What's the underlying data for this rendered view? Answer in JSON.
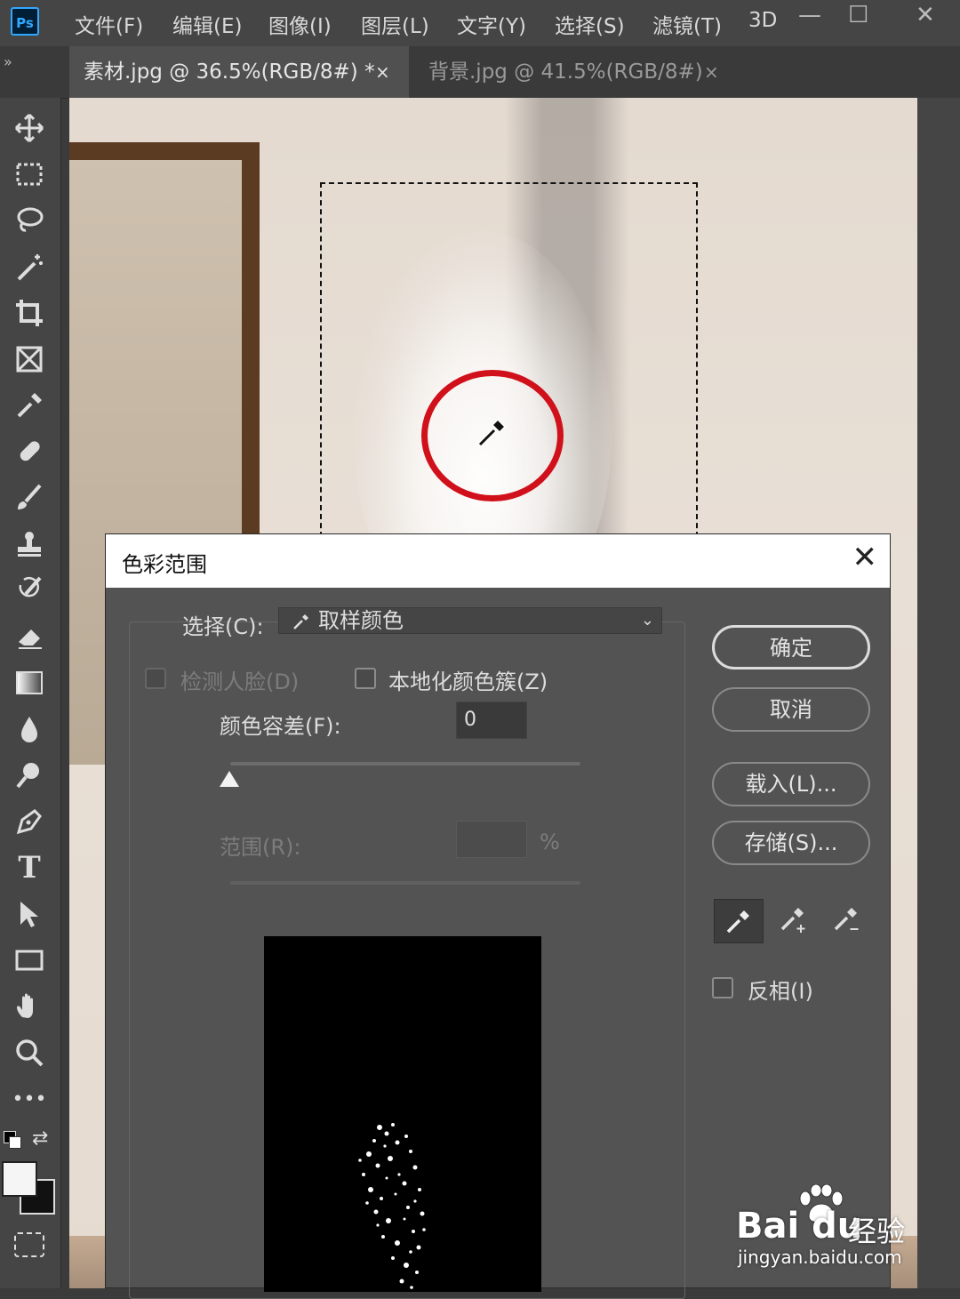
{
  "app": {
    "logo": "Ps"
  },
  "menu": [
    "文件(F)",
    "编辑(E)",
    "图像(I)",
    "图层(L)",
    "文字(Y)",
    "选择(S)",
    "滤镜(T)",
    "3D"
  ],
  "window_controls": {
    "minimize": "—",
    "maximize": "☐",
    "close": "✕"
  },
  "tabs": [
    {
      "title": "素材.jpg @ 36.5%(RGB/8#) *",
      "close": "×",
      "active": true
    },
    {
      "title": "背景.jpg @ 41.5%(RGB/8#)",
      "close": "×",
      "active": false
    }
  ],
  "tools": [
    "move-icon",
    "rect-marquee-icon",
    "lasso-icon",
    "magic-wand-icon",
    "crop-icon",
    "frame-icon",
    "eyedropper-icon",
    "healing-brush-icon",
    "brush-icon",
    "stamp-icon",
    "history-brush-icon",
    "eraser-icon",
    "gradient-icon",
    "blur-icon",
    "dodge-icon",
    "pen-icon",
    "type-icon",
    "path-select-icon",
    "rectangle-icon",
    "hand-icon",
    "zoom-icon",
    "more-icon"
  ],
  "toolbar": {
    "type_glyph": "T",
    "more_glyph": "•••"
  },
  "colors": {
    "foreground": "#f5f5f5",
    "background": "#111111",
    "accent_ring": "#d0101a"
  },
  "dialog": {
    "title": "色彩范围",
    "close": "✕",
    "select_label": "选择(C):",
    "select_value": "取样颜色",
    "detect_faces": {
      "label": "检测人脸(D)",
      "checked": false,
      "enabled": false
    },
    "localized_clusters": {
      "label": "本地化颜色簇(Z)",
      "checked": false
    },
    "fuzziness": {
      "label": "颜色容差(F):",
      "value": "0"
    },
    "range": {
      "label": "范围(R):",
      "unit": "%",
      "enabled": false
    },
    "buttons": {
      "ok": "确定",
      "cancel": "取消",
      "load": "载入(L)...",
      "save": "存储(S)..."
    },
    "invert": {
      "label": "反相(I)",
      "checked": false
    }
  },
  "watermark": {
    "brand": "Bai du",
    "cn": "经验",
    "url": "jingyan.baidu.com"
  }
}
